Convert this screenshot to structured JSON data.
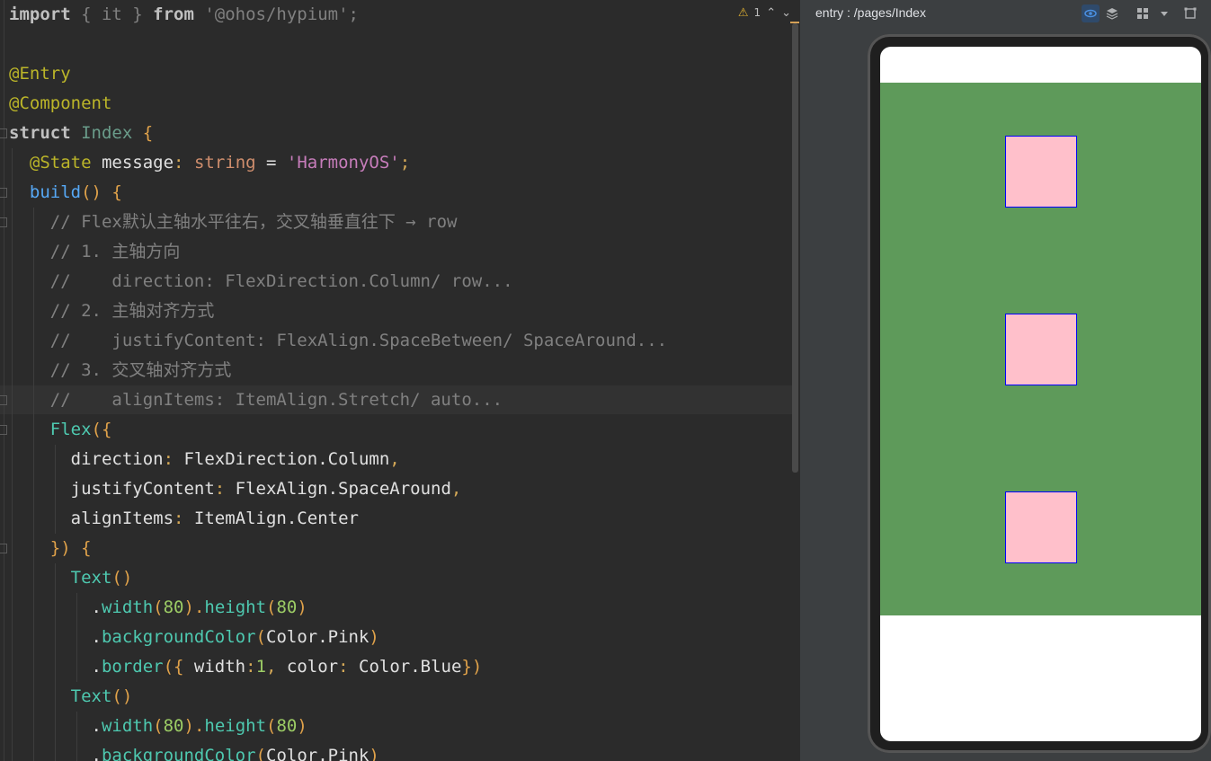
{
  "editor": {
    "warning_count": "1",
    "lines": [
      [
        {
          "t": "import",
          "c": "kw2"
        },
        {
          "t": " { it } ",
          "c": "cm"
        },
        {
          "t": "from",
          "c": "kw2"
        },
        {
          "t": " '@ohos/hypium';",
          "c": "cm"
        }
      ],
      [],
      [
        {
          "t": "@Entry",
          "c": "ann"
        }
      ],
      [
        {
          "t": "@Component",
          "c": "ann"
        }
      ],
      [
        {
          "t": "struct",
          "c": "kw2"
        },
        {
          "t": " ",
          "c": ""
        },
        {
          "t": "Index",
          "c": "type"
        },
        {
          "t": " {",
          "c": "brk"
        }
      ],
      [
        {
          "t": "  ",
          "c": ""
        },
        {
          "t": "@State",
          "c": "ann"
        },
        {
          "t": " message",
          "c": "prop"
        },
        {
          "t": ": ",
          "c": "punc"
        },
        {
          "t": "string",
          "c": "kw"
        },
        {
          "t": " = ",
          "c": "prop"
        },
        {
          "t": "'HarmonyOS'",
          "c": "strP"
        },
        {
          "t": ";",
          "c": "punc"
        }
      ],
      [
        {
          "t": "  ",
          "c": ""
        },
        {
          "t": "build",
          "c": "fn"
        },
        {
          "t": "() {",
          "c": "brk"
        }
      ],
      [
        {
          "t": "    // Flex默认主轴水平往右，交叉轴垂直往下 → row",
          "c": "cm"
        }
      ],
      [
        {
          "t": "    // 1. 主轴方向",
          "c": "cm"
        }
      ],
      [
        {
          "t": "    //    direction: FlexDirection.Column/ row...",
          "c": "cm"
        }
      ],
      [
        {
          "t": "    // 2. 主轴对齐方式",
          "c": "cm"
        }
      ],
      [
        {
          "t": "    //    justifyContent: FlexAlign.SpaceBetween/ SpaceAround...",
          "c": "cm"
        }
      ],
      [
        {
          "t": "    // 3. 交叉轴对齐方式",
          "c": "cm"
        }
      ],
      [
        {
          "t": "    //    alignItems: ItemAlign.Stretch/ auto...",
          "c": "cm"
        }
      ],
      [
        {
          "t": "    ",
          "c": ""
        },
        {
          "t": "Flex",
          "c": "fn2"
        },
        {
          "t": "({",
          "c": "brk"
        }
      ],
      [
        {
          "t": "      direction",
          "c": "prop"
        },
        {
          "t": ": ",
          "c": "punc"
        },
        {
          "t": "FlexDirection.Column",
          "c": "prop"
        },
        {
          "t": ",",
          "c": "punc"
        }
      ],
      [
        {
          "t": "      justifyContent",
          "c": "prop"
        },
        {
          "t": ": ",
          "c": "punc"
        },
        {
          "t": "FlexAlign.SpaceAround",
          "c": "prop"
        },
        {
          "t": ",",
          "c": "punc"
        }
      ],
      [
        {
          "t": "      alignItems",
          "c": "prop"
        },
        {
          "t": ": ",
          "c": "punc"
        },
        {
          "t": "ItemAlign.Center",
          "c": "prop"
        }
      ],
      [
        {
          "t": "    ",
          "c": ""
        },
        {
          "t": "}) {",
          "c": "brk"
        }
      ],
      [
        {
          "t": "      ",
          "c": ""
        },
        {
          "t": "Text",
          "c": "fn2"
        },
        {
          "t": "()",
          "c": "brk"
        }
      ],
      [
        {
          "t": "        .",
          "c": "prop"
        },
        {
          "t": "width",
          "c": "fn2"
        },
        {
          "t": "(",
          "c": "brk"
        },
        {
          "t": "80",
          "c": "num"
        },
        {
          "t": ").",
          "c": "brk"
        },
        {
          "t": "height",
          "c": "fn2"
        },
        {
          "t": "(",
          "c": "brk"
        },
        {
          "t": "80",
          "c": "num"
        },
        {
          "t": ")",
          "c": "brk"
        }
      ],
      [
        {
          "t": "        .",
          "c": "prop"
        },
        {
          "t": "backgroundColor",
          "c": "fn2"
        },
        {
          "t": "(",
          "c": "brk"
        },
        {
          "t": "Color.Pink",
          "c": "prop"
        },
        {
          "t": ")",
          "c": "brk"
        }
      ],
      [
        {
          "t": "        .",
          "c": "prop"
        },
        {
          "t": "border",
          "c": "fn2"
        },
        {
          "t": "({ ",
          "c": "brk"
        },
        {
          "t": "width",
          "c": "prop"
        },
        {
          "t": ":",
          "c": "punc"
        },
        {
          "t": "1",
          "c": "num"
        },
        {
          "t": ", ",
          "c": "punc"
        },
        {
          "t": "color",
          "c": "prop"
        },
        {
          "t": ": ",
          "c": "punc"
        },
        {
          "t": "Color.Blue",
          "c": "prop"
        },
        {
          "t": "})",
          "c": "brk"
        }
      ],
      [
        {
          "t": "      ",
          "c": ""
        },
        {
          "t": "Text",
          "c": "fn2"
        },
        {
          "t": "()",
          "c": "brk"
        }
      ],
      [
        {
          "t": "        .",
          "c": "prop"
        },
        {
          "t": "width",
          "c": "fn2"
        },
        {
          "t": "(",
          "c": "brk"
        },
        {
          "t": "80",
          "c": "num"
        },
        {
          "t": ").",
          "c": "brk"
        },
        {
          "t": "height",
          "c": "fn2"
        },
        {
          "t": "(",
          "c": "brk"
        },
        {
          "t": "80",
          "c": "num"
        },
        {
          "t": ")",
          "c": "brk"
        }
      ],
      [
        {
          "t": "        .",
          "c": "prop"
        },
        {
          "t": "backgroundColor",
          "c": "fn2"
        },
        {
          "t": "(",
          "c": "brk"
        },
        {
          "t": "Color.Pink",
          "c": "prop"
        },
        {
          "t": ")",
          "c": "brk"
        }
      ]
    ]
  },
  "preview": {
    "title": "entry : /pages/Index",
    "colors": {
      "flex_bg": "#5e9a5a",
      "box_fill": "#ffc0cb",
      "box_border": "#0000ff"
    }
  }
}
